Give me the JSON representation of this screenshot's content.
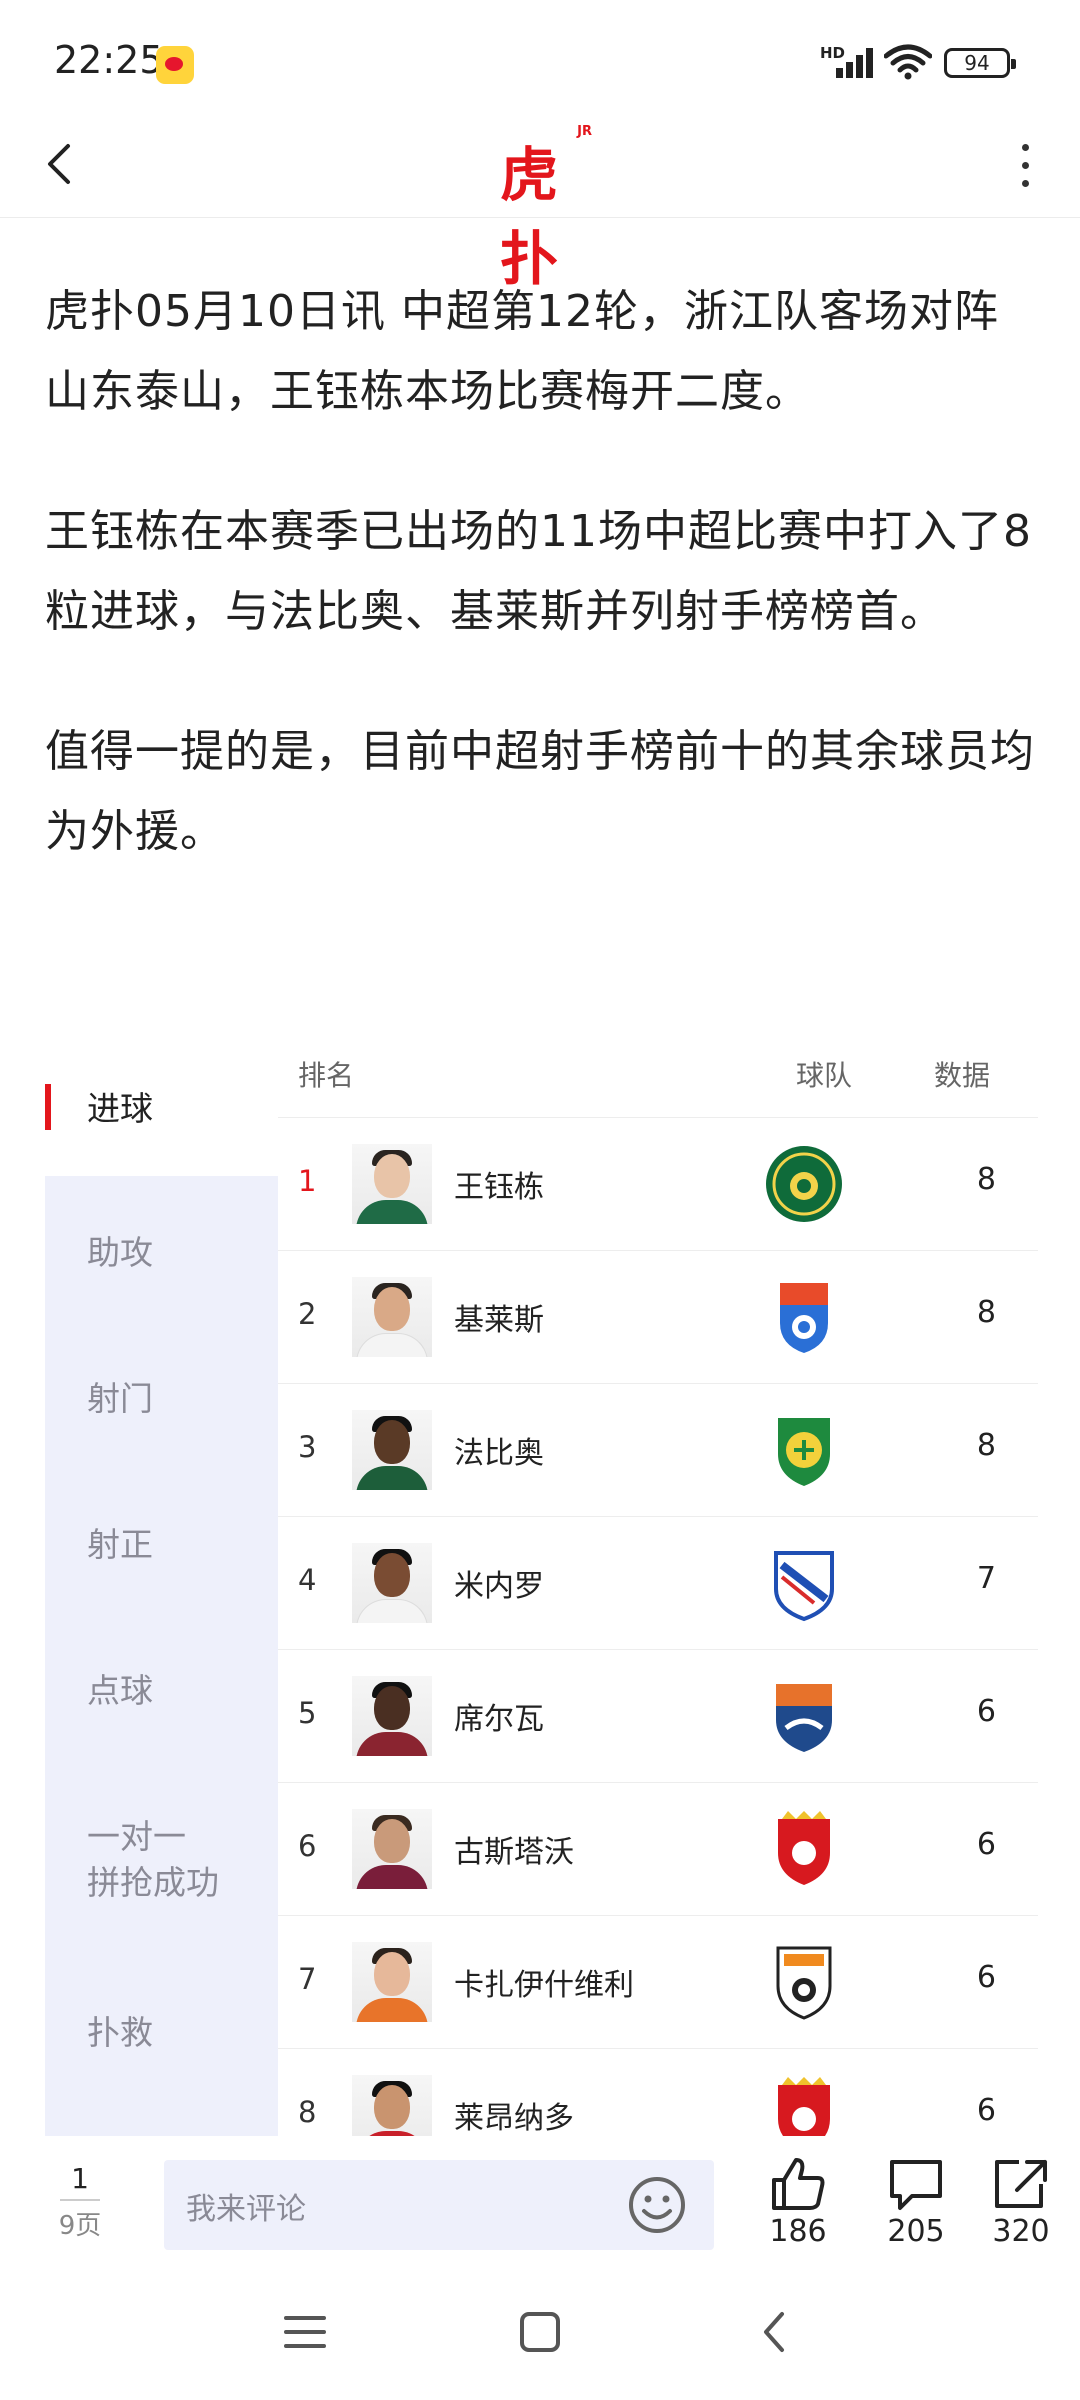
{
  "status_bar": {
    "time": "22:25",
    "network_label": "HD",
    "battery": "94"
  },
  "header": {
    "logo_text": "虎扑",
    "logo_badge": "JR"
  },
  "article": {
    "paragraphs": [
      "虎扑05月10日讯 中超第12轮，浙江队客场对阵山东泰山，王钰栋本场比赛梅开二度。",
      "王钰栋在本赛季已出场的11场中超比赛中打入了8粒进球，与法比奥、基莱斯并列射手榜榜首。",
      "值得一提的是，目前中超射手榜前十的其余球员均为外援。"
    ]
  },
  "stats": {
    "categories": [
      "进球",
      "助攻",
      "射门",
      "射正",
      "点球",
      "一对一\n拼抢成功",
      "扑救"
    ],
    "active_category": "进球",
    "columns": {
      "rank": "排名",
      "team": "球队",
      "data": "数据"
    },
    "rows": [
      {
        "rank": "1",
        "name": "王钰栋",
        "team_icon": "zhejiang-crest-icon",
        "value": "8"
      },
      {
        "rank": "2",
        "name": "基莱斯",
        "team_icon": "jinmen-tiger-crest-icon",
        "value": "8"
      },
      {
        "rank": "3",
        "name": "法比奥",
        "team_icon": "beijing-guoan-crest-icon",
        "value": "8"
      },
      {
        "rank": "4",
        "name": "米内罗",
        "team_icon": "shanghai-shenhua-crest-icon",
        "value": "7"
      },
      {
        "rank": "5",
        "name": "席尔瓦",
        "team_icon": "qingdao-hainiu-crest-icon",
        "value": "6"
      },
      {
        "rank": "6",
        "name": "古斯塔沃",
        "team_icon": "shanghai-port-crest-icon",
        "value": "6"
      },
      {
        "rank": "7",
        "name": "卡扎伊什维利",
        "team_icon": "shandong-taishan-crest-icon",
        "value": "6"
      },
      {
        "rank": "8",
        "name": "莱昂纳多",
        "team_icon": "shanghai-port-crest-icon",
        "value": "6"
      }
    ]
  },
  "bottom_bar": {
    "page_current": "1",
    "page_total": "9页",
    "comment_placeholder": "我来评论",
    "likes": "186",
    "comments": "205",
    "shares": "320"
  },
  "colors": {
    "brand_red": "#e3161c",
    "sidebar_bg": "#eef0fb"
  }
}
